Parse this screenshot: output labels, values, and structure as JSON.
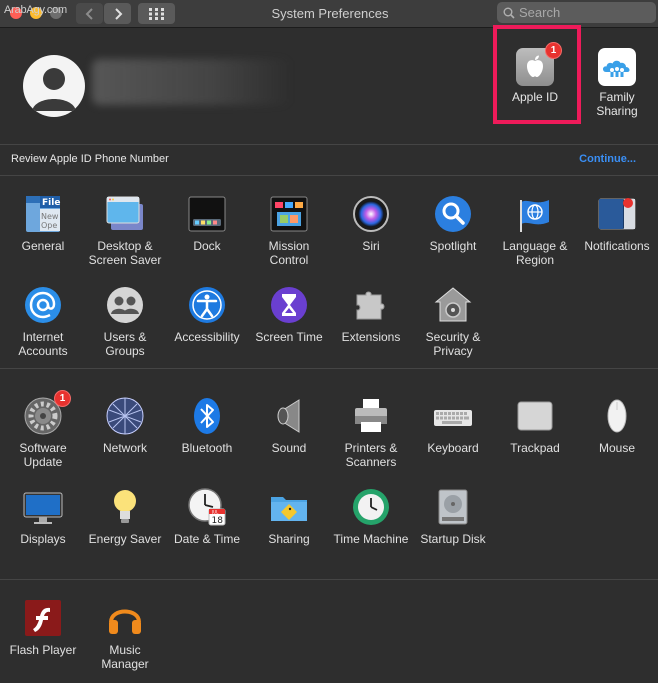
{
  "watermark": "ArabAgy.com",
  "window": {
    "title": "System Preferences"
  },
  "search": {
    "placeholder": "Search"
  },
  "account": {
    "apple_id": {
      "label": "Apple ID",
      "badge": "1"
    },
    "family_sharing": {
      "label": "Family Sharing"
    }
  },
  "notice": {
    "message": "Review Apple ID Phone Number",
    "action": "Continue..."
  },
  "rows": {
    "row1": [
      {
        "label": "General"
      },
      {
        "label": "Desktop & Screen Saver"
      },
      {
        "label": "Dock"
      },
      {
        "label": "Mission Control"
      },
      {
        "label": "Siri"
      },
      {
        "label": "Spotlight"
      },
      {
        "label": "Language & Region"
      },
      {
        "label": "Notifications"
      }
    ],
    "row2": [
      {
        "label": "Internet Accounts"
      },
      {
        "label": "Users & Groups"
      },
      {
        "label": "Accessibility"
      },
      {
        "label": "Screen Time"
      },
      {
        "label": "Extensions"
      },
      {
        "label": "Security & Privacy"
      }
    ],
    "row3": [
      {
        "label": "Software Update",
        "badge": "1"
      },
      {
        "label": "Network"
      },
      {
        "label": "Bluetooth"
      },
      {
        "label": "Sound"
      },
      {
        "label": "Printers & Scanners"
      },
      {
        "label": "Keyboard"
      },
      {
        "label": "Trackpad"
      },
      {
        "label": "Mouse"
      }
    ],
    "row4": [
      {
        "label": "Displays"
      },
      {
        "label": "Energy Saver"
      },
      {
        "label": "Date & Time"
      },
      {
        "label": "Sharing"
      },
      {
        "label": "Time Machine"
      },
      {
        "label": "Startup Disk"
      }
    ],
    "row5": [
      {
        "label": "Flash Player"
      },
      {
        "label": "Music Manager"
      }
    ]
  },
  "icon_text": {
    "general_file": "File",
    "general_new": "New",
    "general_open": "Ope",
    "calendar_month": "JUL",
    "calendar_day": "18"
  },
  "colors": {
    "accent": "#3a8ff5",
    "highlight": "#ee1b5a",
    "badge": "#e8322f"
  }
}
